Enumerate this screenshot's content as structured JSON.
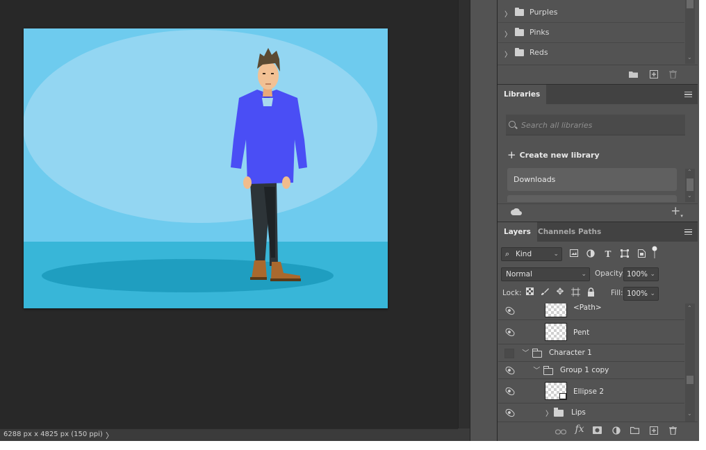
{
  "status": {
    "document_info": "6288 px x 4825 px (150 ppi)"
  },
  "swatches": {
    "groups": [
      {
        "label": "Purples"
      },
      {
        "label": "Pinks"
      },
      {
        "label": "Reds"
      }
    ]
  },
  "libraries": {
    "tab_label": "Libraries",
    "search_placeholder": "Search all libraries",
    "create_label": "Create new library",
    "items": [
      {
        "label": "Downloads"
      }
    ]
  },
  "layers": {
    "tabs": [
      {
        "label": "Layers",
        "active": true
      },
      {
        "label": "Channels",
        "active": false
      },
      {
        "label": "Paths",
        "active": false
      }
    ],
    "filter_kind": "Kind",
    "blend_mode": "Normal",
    "opacity_label": "Opacity:",
    "opacity_value": "100%",
    "lock_label": "Lock:",
    "fill_label": "Fill:",
    "fill_value": "100%",
    "rows": [
      {
        "name": "<Path>",
        "visible": true,
        "type": "layer"
      },
      {
        "name": "Pent",
        "visible": true,
        "type": "layer"
      },
      {
        "name": "Character 1",
        "visible": false,
        "type": "group",
        "expanded": true
      },
      {
        "name": "Group 1 copy",
        "visible": true,
        "type": "group",
        "expanded": true
      },
      {
        "name": "Ellipse 2",
        "visible": true,
        "type": "shape"
      },
      {
        "name": "Lips",
        "visible": true,
        "type": "group",
        "expanded": false
      }
    ]
  },
  "colors": {
    "workspace_bg": "#282828",
    "panel_bg": "#535353",
    "canvas_sky": "#6ecbee",
    "canvas_ellipse": "#93d6f2",
    "canvas_floor": "#38b6d8",
    "canvas_shadow": "#1f9ec0",
    "shirt": "#4a4ef5"
  }
}
